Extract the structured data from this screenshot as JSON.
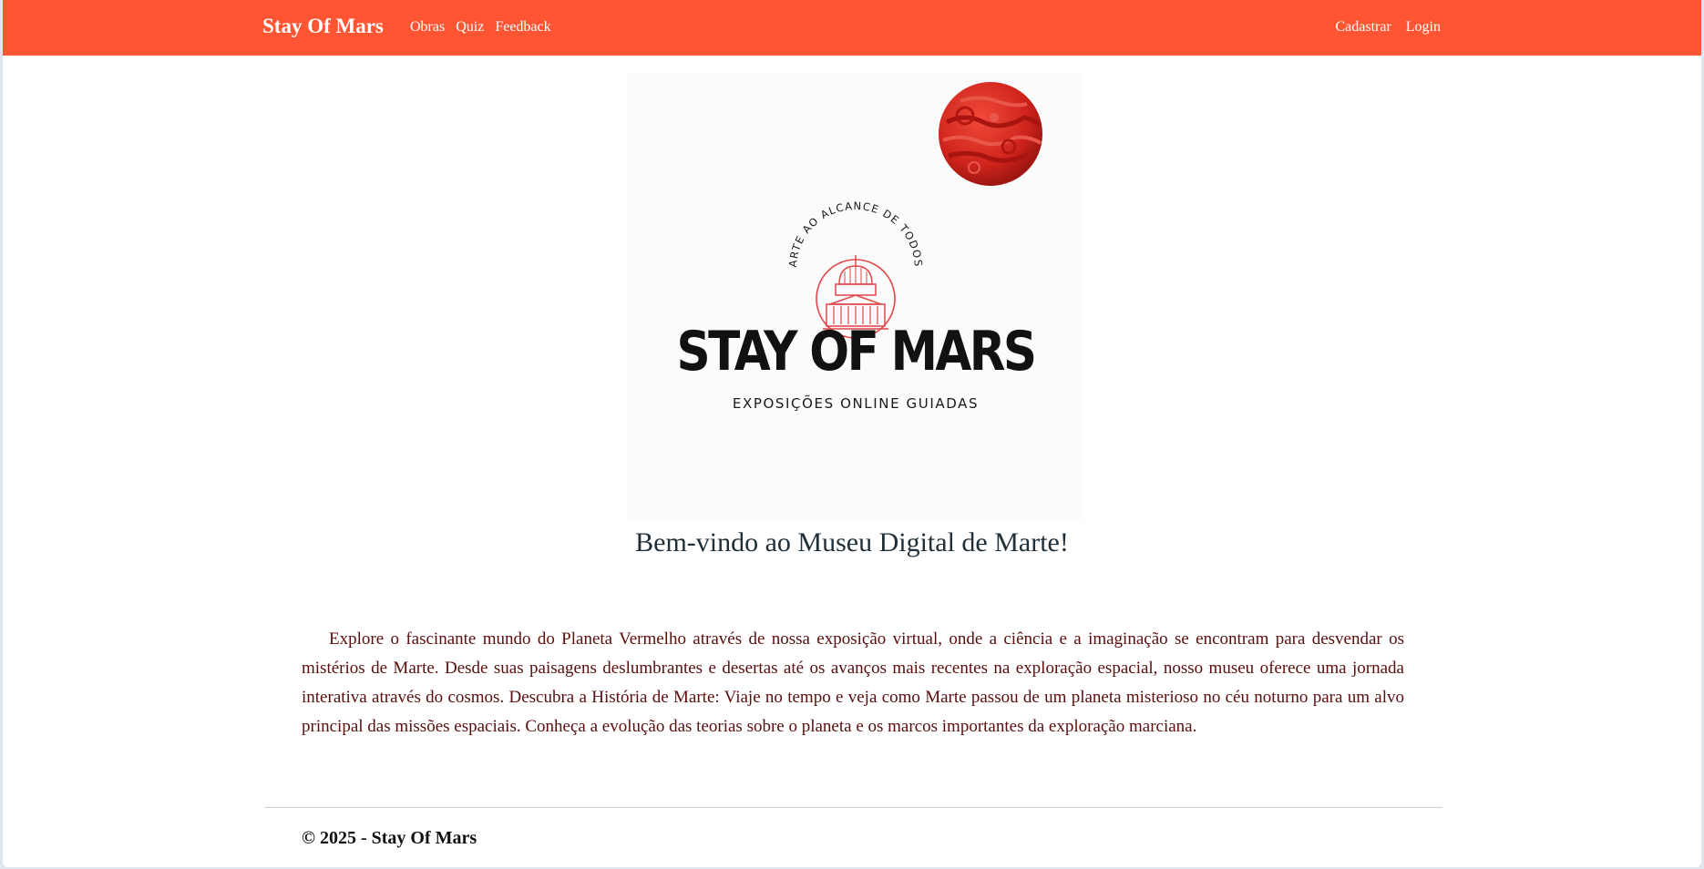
{
  "nav": {
    "brand": "Stay Of Mars",
    "links": [
      "Obras",
      "Quiz",
      "Feedback"
    ],
    "auth": [
      "Cadastrar",
      "Login"
    ]
  },
  "logo": {
    "arc_text": "ARTE AO ALCANCE DE TODOS",
    "title": "STAY OF MARS",
    "subtitle": "EXPOSIÇÕES ONLINE GUIADAS"
  },
  "main": {
    "heading": "Bem-vindo ao Museu Digital de Marte!",
    "intro": "Explore o fascinante mundo do Planeta Vermelho através de nossa exposição virtual, onde a ciência e a imaginação se encontram para desvendar os mistérios de Marte. Desde suas paisagens deslumbrantes e desertas até os avanços mais recentes na exploração espacial, nosso museu oferece uma jornada interativa através do cosmos. Descubra a História de Marte: Viaje no tempo e veja como Marte passou de um planeta misterioso no céu noturno para um alvo principal das missões espaciais. Conheça a evolução das teorias sobre o planeta e os marcos importantes da exploração marciana."
  },
  "footer": {
    "copyright": "© 2025 - Stay Of Mars"
  },
  "colors": {
    "navbar": "#ff5533",
    "planet": "#d42a22",
    "intro_text": "#5a0e0e",
    "emblem": "#e0474a"
  }
}
